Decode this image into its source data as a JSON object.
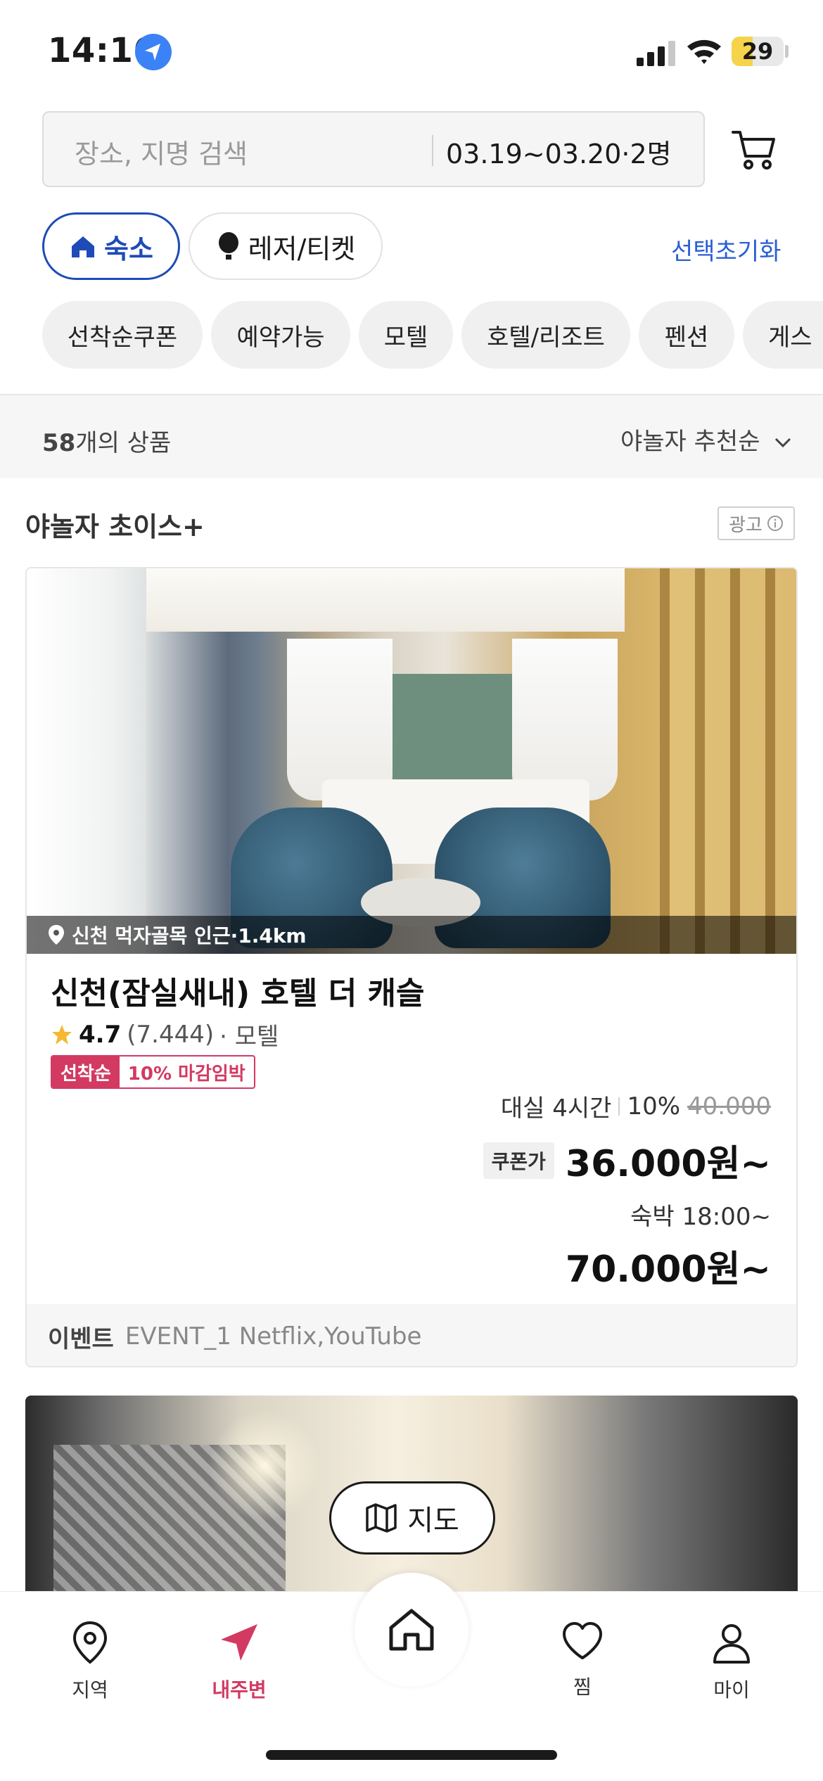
{
  "status_bar": {
    "time": "14:16",
    "battery": "29",
    "battery_level": 0.29
  },
  "search": {
    "placeholder": "장소, 지명 검색",
    "dates": "03.19~03.20·2명"
  },
  "categories": [
    {
      "label": "숙소",
      "active": true
    },
    {
      "label": "레저/티켓",
      "active": false
    }
  ],
  "reset_label": "선택초기화",
  "filters": [
    "선착순쿠폰",
    "예약가능",
    "모텔",
    "호텔/리조트",
    "펜션",
    "게스"
  ],
  "results": {
    "count": "58",
    "count_suffix": "개의 상품",
    "sort": "야놀자 추천순"
  },
  "section": {
    "title": "야놀자 초이스+",
    "ad_label": "광고"
  },
  "listing": {
    "location": "신천 먹자골목 인근·1.4km",
    "name": "신천(잠실새내) 호텔 더 캐슬",
    "rating": "4.7",
    "reviews": "(7.444)",
    "type": "· 모텔",
    "coupon_tag_left": "선착순",
    "coupon_tag_right": "10% 마감임박",
    "rent_label": "대실 4시간",
    "discount": "10%",
    "original_price": "40.000",
    "coupon_badge": "쿠폰가",
    "coupon_price": "36.000원~",
    "stay_label": "숙박 18:00~",
    "stay_price": "70.000원~",
    "event_label": "이벤트",
    "event_text": "EVENT_1 Netflix,YouTube"
  },
  "map_button": "지도",
  "tabs": [
    {
      "label": "지역",
      "icon": "location-pin-icon",
      "active": false
    },
    {
      "label": "내주변",
      "icon": "navigation-arrow-icon",
      "active": true
    },
    {
      "label": "",
      "icon": "home-icon",
      "active": false
    },
    {
      "label": "찜",
      "icon": "heart-icon",
      "active": false
    },
    {
      "label": "마이",
      "icon": "person-icon",
      "active": false
    }
  ],
  "colors": {
    "accent_blue": "#1e4bb8",
    "accent_pink": "#d23a62"
  }
}
